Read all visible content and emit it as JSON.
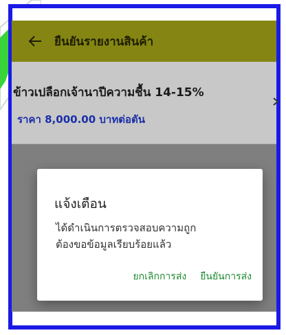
{
  "app_bar": {
    "title": "ยืนยันรายงานสินค้า",
    "back_icon": "arrow-left-icon",
    "background": "#858514"
  },
  "product": {
    "name": "ข้าวเปลือกเจ้านาปีความชื้น 14-15%",
    "price": "ราคา 8,000.00 บาทต่อตัน",
    "chevron_icon": "chevron-right-icon"
  },
  "dialog": {
    "title": "แจ้งเตือน",
    "message_line1": "ได้ดำเนินการตรวจสอบความถูก",
    "message_line2": "ต้องขอข้อมูลเรียบร้อยแล้ว",
    "cancel_label": "ยกเลิกการส่ง",
    "confirm_label": "ยืนยันการส่ง",
    "action_color": "#1c8a2f"
  },
  "colors": {
    "frame_border": "#1a1ae6",
    "overlay": "#7f7f7f",
    "price_text": "#1a2fa8"
  }
}
